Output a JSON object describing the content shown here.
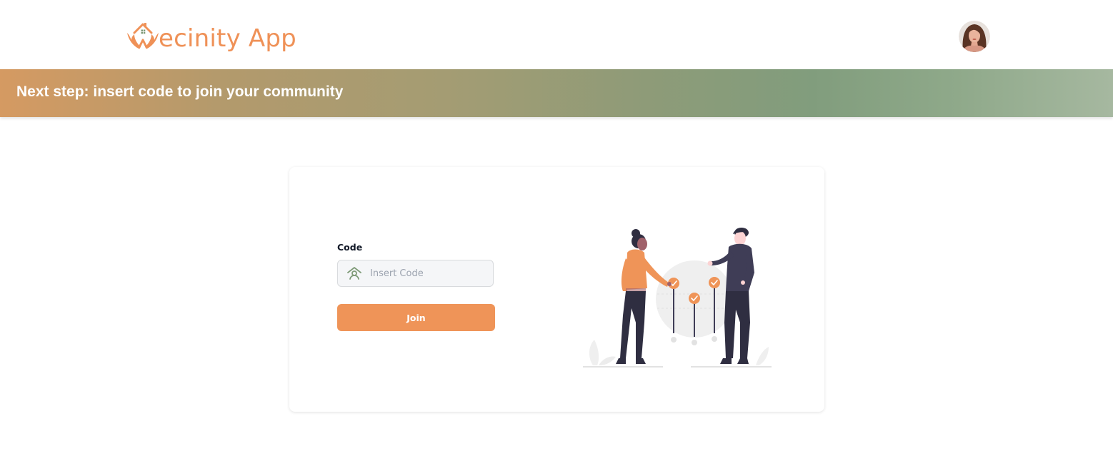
{
  "app": {
    "logo_letter": "V",
    "logo_text": "ecinity App",
    "brand_color": "#ef9157"
  },
  "header": {
    "avatar_icon": "user-avatar"
  },
  "banner": {
    "title": "Next step: insert code to join your community",
    "gradient_colors": [
      "#d59a62",
      "#a49c73",
      "#819d7d",
      "#a6b8a0"
    ]
  },
  "join_form": {
    "code_label": "Code",
    "code_value": "",
    "code_placeholder": "Insert Code",
    "code_icon": "community-person-icon",
    "join_label": "Join",
    "join_color": "#ef9458"
  },
  "illustration": {
    "icon": "team-collaboration-illustration",
    "accent_color": "#ef9458"
  }
}
